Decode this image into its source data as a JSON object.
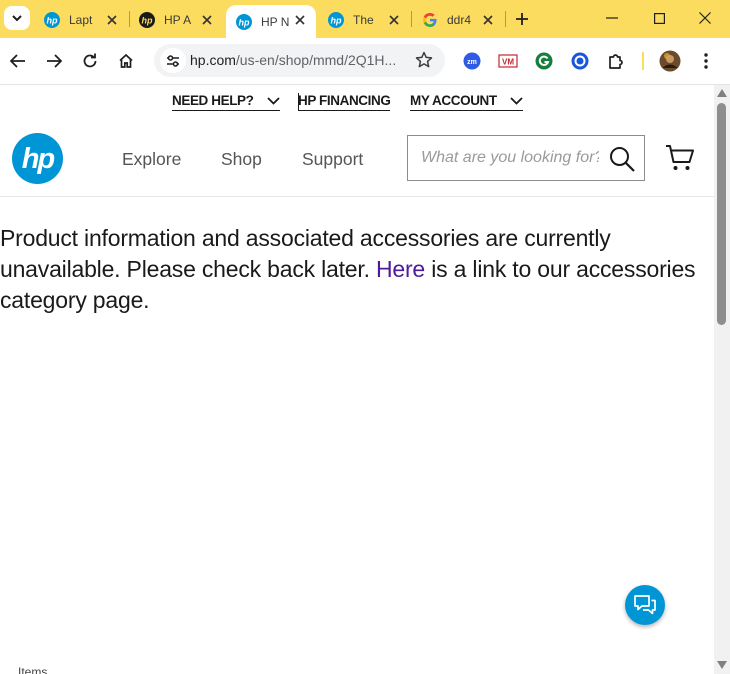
{
  "browser": {
    "tabs": [
      {
        "title": "Lapt",
        "favicon": "hp-logo-icon"
      },
      {
        "title": "HP A",
        "favicon": "hp-logo-dark-icon"
      },
      {
        "title": "HP N",
        "favicon": "hp-logo-icon",
        "active": true
      },
      {
        "title": "The",
        "favicon": "hp-logo-icon"
      },
      {
        "title": "ddr4",
        "favicon": "google-g-icon"
      }
    ],
    "url_host": "hp.com",
    "url_path": "/us-en/shop/mmd/2Q1H...",
    "extensions": [
      "zoom-extension-icon",
      "vm-extension-icon",
      "grammarly-extension-icon",
      "circle-extension-icon",
      "puzzle-extensions-icon",
      "profile-avatar",
      "kebab-menu-icon"
    ]
  },
  "utility_nav": {
    "need_help": "NEED HELP?",
    "financing": "HP FINANCING",
    "account": "MY ACCOUNT"
  },
  "header": {
    "logo_text": "hp",
    "nav": [
      "Explore",
      "Shop",
      "Support"
    ],
    "search_placeholder": "What are you looking for?"
  },
  "main": {
    "message_before": "Product information and associated accessories are currently unavailable. Please check back later. ",
    "message_link": "Here",
    "message_after": " is a link to our accessories category page."
  },
  "footer_peek": "Items",
  "colors": {
    "tabstrip": "#fbdc5e",
    "hp_blue": "#0096d6",
    "link_purple": "#4e1a9c"
  }
}
